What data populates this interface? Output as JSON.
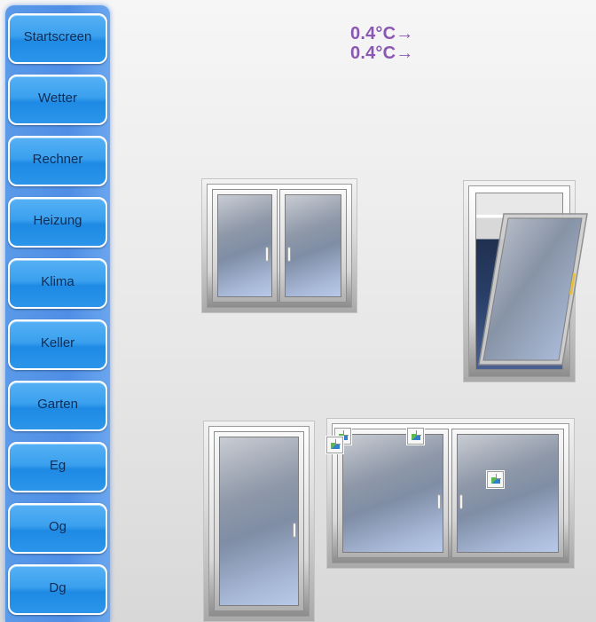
{
  "navigation": {
    "items": [
      {
        "label": "Startscreen"
      },
      {
        "label": "Wetter"
      },
      {
        "label": "Rechner"
      },
      {
        "label": "Heizung"
      },
      {
        "label": "Klima"
      },
      {
        "label": "Keller"
      },
      {
        "label": "Garten"
      },
      {
        "label": "Eg"
      },
      {
        "label": "Og"
      },
      {
        "label": "Dg"
      }
    ]
  },
  "readings": {
    "temperature_1": "0.4°C→",
    "temperature_2": "0.4°C→"
  },
  "windows": [
    {
      "name": "double-window-upper-left",
      "state": "closed"
    },
    {
      "name": "tilted-window-right",
      "state": "tilted"
    },
    {
      "name": "single-window-lower-left",
      "state": "closed"
    },
    {
      "name": "double-window-lower-right",
      "state": "closed"
    }
  ],
  "colors": {
    "nav_button": "#2b95ea",
    "nav_text": "#0f2c55",
    "temperature_text": "#8a57b3",
    "sidebar": "#4f8ee6"
  },
  "icons": {
    "broken_image": "broken-image-icon",
    "window_handle": "window-handle-icon"
  }
}
